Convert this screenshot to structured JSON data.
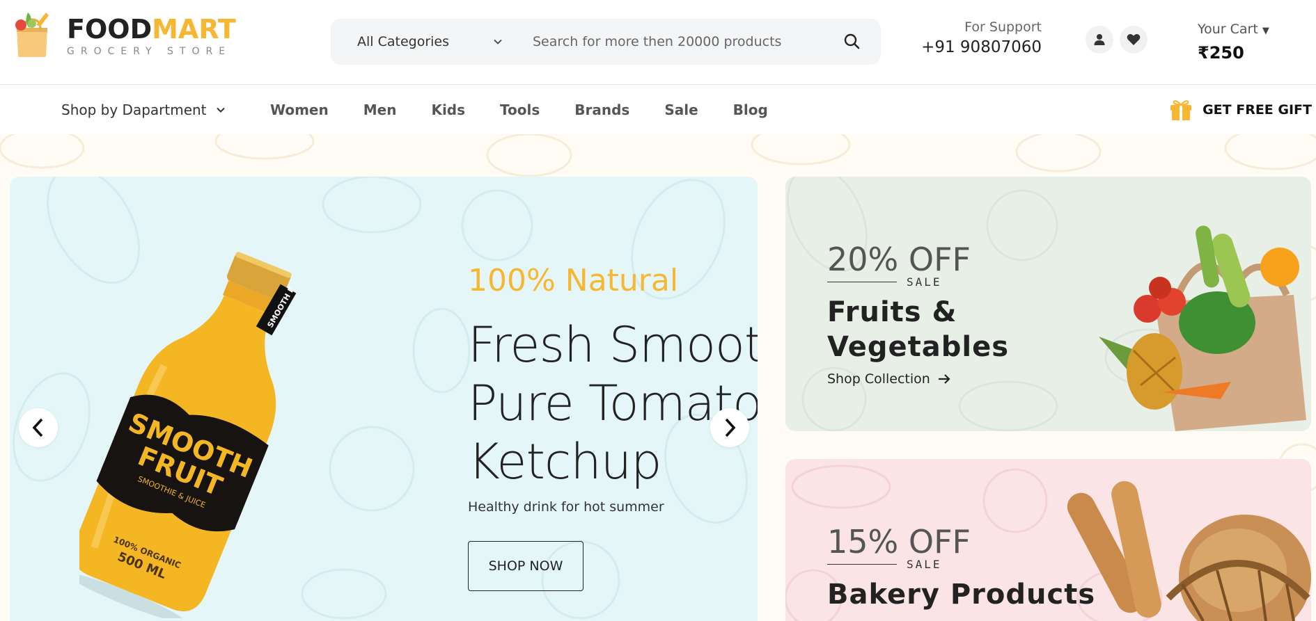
{
  "colors": {
    "accent": "#f7b733",
    "slider_bg": "#e5f6f8",
    "promo1_bg": "#e8efe7",
    "promo2_bg": "#fbe4e6"
  },
  "brand": {
    "name_part1": "FOOD",
    "name_part2": "MART",
    "tagline": "GROCERY STORE"
  },
  "search": {
    "category": "All Categories",
    "placeholder": "Search for more then 20000 products"
  },
  "support": {
    "label": "For Support",
    "phone": "+91 90807060"
  },
  "cart": {
    "label": "Your Cart",
    "total": "₹250"
  },
  "nav": {
    "department": "Shop by Dapartment",
    "links": [
      "Women",
      "Men",
      "Kids",
      "Tools",
      "Brands",
      "Sale",
      "Blog"
    ],
    "gift": "GET FREE GIFT"
  },
  "slider": {
    "eyebrow": "100% Natural",
    "title_lines": [
      "Fresh Smoothie &",
      "Pure Tomato",
      "Ketchup"
    ],
    "subtitle": "Healthy drink for hot summer",
    "cta": "SHOP NOW",
    "bottle_label_1": "SMOOTH",
    "bottle_label_2": "FRUIT",
    "bottle_label_3": "SMOOTHIE & JUICE",
    "bottle_label_4": "100% ORGANIC",
    "bottle_label_5": "500 ML",
    "bottle_neck": "SMOOTH F"
  },
  "promos": [
    {
      "discount": "20% OFF",
      "sale": "SALE",
      "title_lines": [
        "Fruits &",
        "Vegetables"
      ],
      "link": "Shop Collection"
    },
    {
      "discount": "15% OFF",
      "sale": "SALE",
      "title_lines": [
        "Bakery Products"
      ]
    }
  ]
}
